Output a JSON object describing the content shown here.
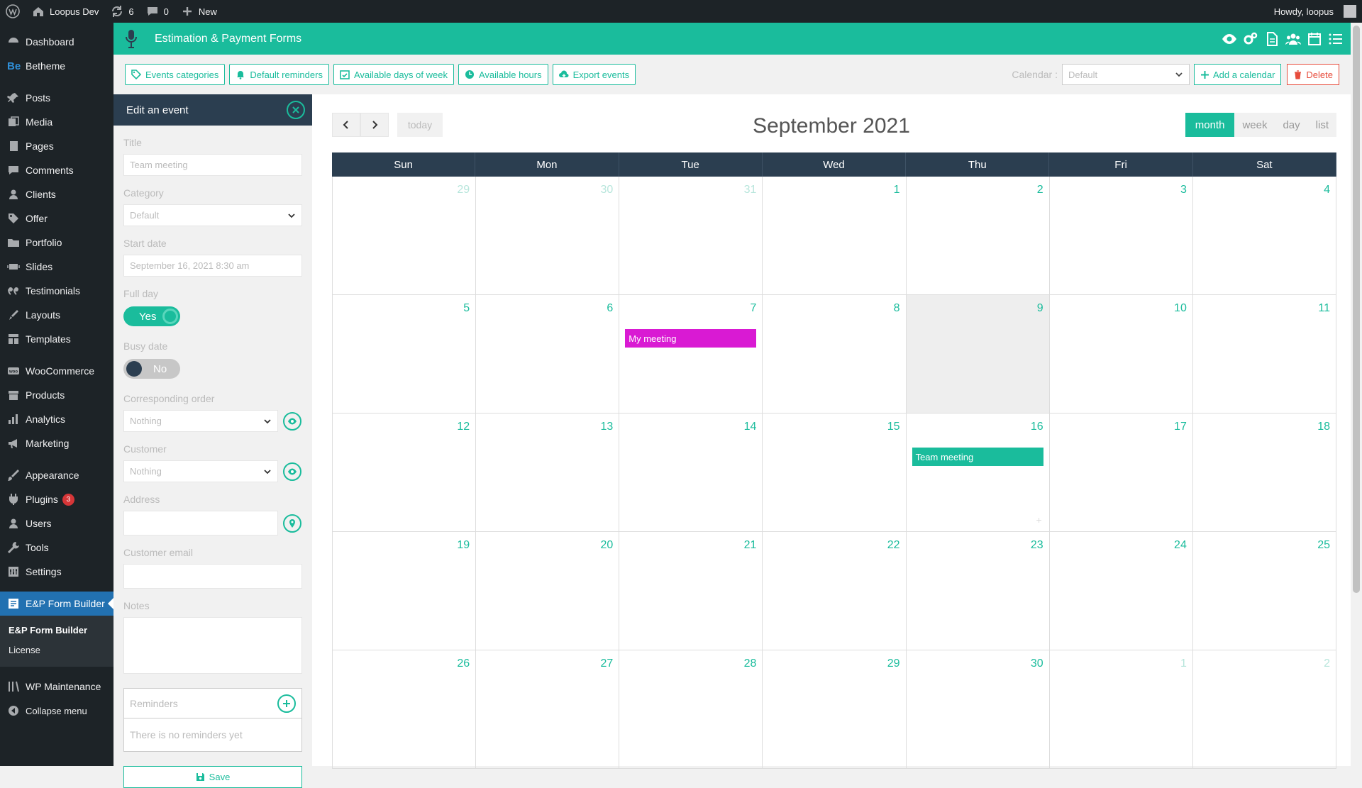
{
  "admin_bar": {
    "site_name": "Loopus Dev",
    "updates_count": "6",
    "comments_count": "0",
    "new_label": "New",
    "howdy": "Howdy, loopus"
  },
  "sidebar": {
    "items": [
      {
        "label": "Dashboard",
        "icon": "dashboard-icon"
      },
      {
        "label": "Betheme",
        "icon": "betheme-logo"
      },
      {
        "label": "Posts",
        "icon": "pin-icon"
      },
      {
        "label": "Media",
        "icon": "media-icon"
      },
      {
        "label": "Pages",
        "icon": "pages-icon"
      },
      {
        "label": "Comments",
        "icon": "comments-icon"
      },
      {
        "label": "Clients",
        "icon": "person-icon"
      },
      {
        "label": "Offer",
        "icon": "tag-icon"
      },
      {
        "label": "Portfolio",
        "icon": "folder-icon"
      },
      {
        "label": "Slides",
        "icon": "slides-icon"
      },
      {
        "label": "Testimonials",
        "icon": "quote-icon"
      },
      {
        "label": "Layouts",
        "icon": "brush-icon"
      },
      {
        "label": "Templates",
        "icon": "grid-icon"
      },
      {
        "label": "WooCommerce",
        "icon": "woo-icon"
      },
      {
        "label": "Products",
        "icon": "archive-icon"
      },
      {
        "label": "Analytics",
        "icon": "bar-chart-icon"
      },
      {
        "label": "Marketing",
        "icon": "megaphone-icon"
      },
      {
        "label": "Appearance",
        "icon": "paintbrush-icon"
      },
      {
        "label": "Plugins",
        "icon": "plugin-icon",
        "badge": "3"
      },
      {
        "label": "Users",
        "icon": "users-icon"
      },
      {
        "label": "Tools",
        "icon": "wrench-icon"
      },
      {
        "label": "Settings",
        "icon": "settings-icon"
      },
      {
        "label": "E&P Form Builder",
        "icon": "form-icon"
      },
      {
        "label": "WP Maintenance",
        "icon": "maintenance-icon"
      },
      {
        "label": "Collapse menu",
        "icon": "collapse-icon"
      }
    ],
    "submenu": [
      "E&P Form Builder",
      "License"
    ]
  },
  "header": {
    "title": "Estimation & Payment Forms"
  },
  "toolbar": {
    "buttons": [
      "Events categories",
      "Default reminders",
      "Available days of week",
      "Available hours",
      "Export events"
    ],
    "calendar_label": "Calendar :",
    "calendar_value": "Default",
    "add_calendar": "Add a calendar",
    "delete": "Delete"
  },
  "edit_panel": {
    "title": "Edit an event",
    "title_label": "Title",
    "title_value": "Team meeting",
    "category_label": "Category",
    "category_value": "Default",
    "start_label": "Start date",
    "start_value": "September 16, 2021 8:30 am",
    "fullday_label": "Full day",
    "fullday_value": "Yes",
    "busy_label": "Busy date",
    "busy_value": "No",
    "order_label": "Corresponding order",
    "order_value": "Nothing",
    "customer_label": "Customer",
    "customer_value": "Nothing",
    "address_label": "Address",
    "email_label": "Customer email",
    "notes_label": "Notes",
    "reminders_label": "Reminders",
    "reminders_empty": "There is no reminders yet",
    "save": "Save"
  },
  "calendar": {
    "today": "today",
    "title": "September 2021",
    "views": [
      "month",
      "week",
      "day",
      "list"
    ],
    "active_view": "month",
    "days": [
      "Sun",
      "Mon",
      "Tue",
      "Wed",
      "Thu",
      "Fri",
      "Sat"
    ],
    "weeks": [
      [
        {
          "d": "29",
          "o": true
        },
        {
          "d": "30",
          "o": true
        },
        {
          "d": "31",
          "o": true
        },
        {
          "d": "1"
        },
        {
          "d": "2"
        },
        {
          "d": "3"
        },
        {
          "d": "4"
        }
      ],
      [
        {
          "d": "5"
        },
        {
          "d": "6"
        },
        {
          "d": "7",
          "event": "My meeting",
          "color": "#d91ad3"
        },
        {
          "d": "8"
        },
        {
          "d": "9",
          "today": true
        },
        {
          "d": "10"
        },
        {
          "d": "11"
        }
      ],
      [
        {
          "d": "12"
        },
        {
          "d": "13"
        },
        {
          "d": "14"
        },
        {
          "d": "15"
        },
        {
          "d": "16",
          "event": "Team meeting",
          "color": "#1abc9c",
          "plus": true
        },
        {
          "d": "17"
        },
        {
          "d": "18"
        }
      ],
      [
        {
          "d": "19"
        },
        {
          "d": "20"
        },
        {
          "d": "21"
        },
        {
          "d": "22"
        },
        {
          "d": "23"
        },
        {
          "d": "24"
        },
        {
          "d": "25"
        }
      ],
      [
        {
          "d": "26"
        },
        {
          "d": "27"
        },
        {
          "d": "28"
        },
        {
          "d": "29"
        },
        {
          "d": "30"
        },
        {
          "d": "1",
          "o": true
        },
        {
          "d": "2",
          "o": true
        }
      ]
    ]
  },
  "colors": {
    "accent": "#1abc9c",
    "dark": "#2b3e50",
    "danger": "#e74c3c",
    "event_pink": "#d91ad3"
  }
}
